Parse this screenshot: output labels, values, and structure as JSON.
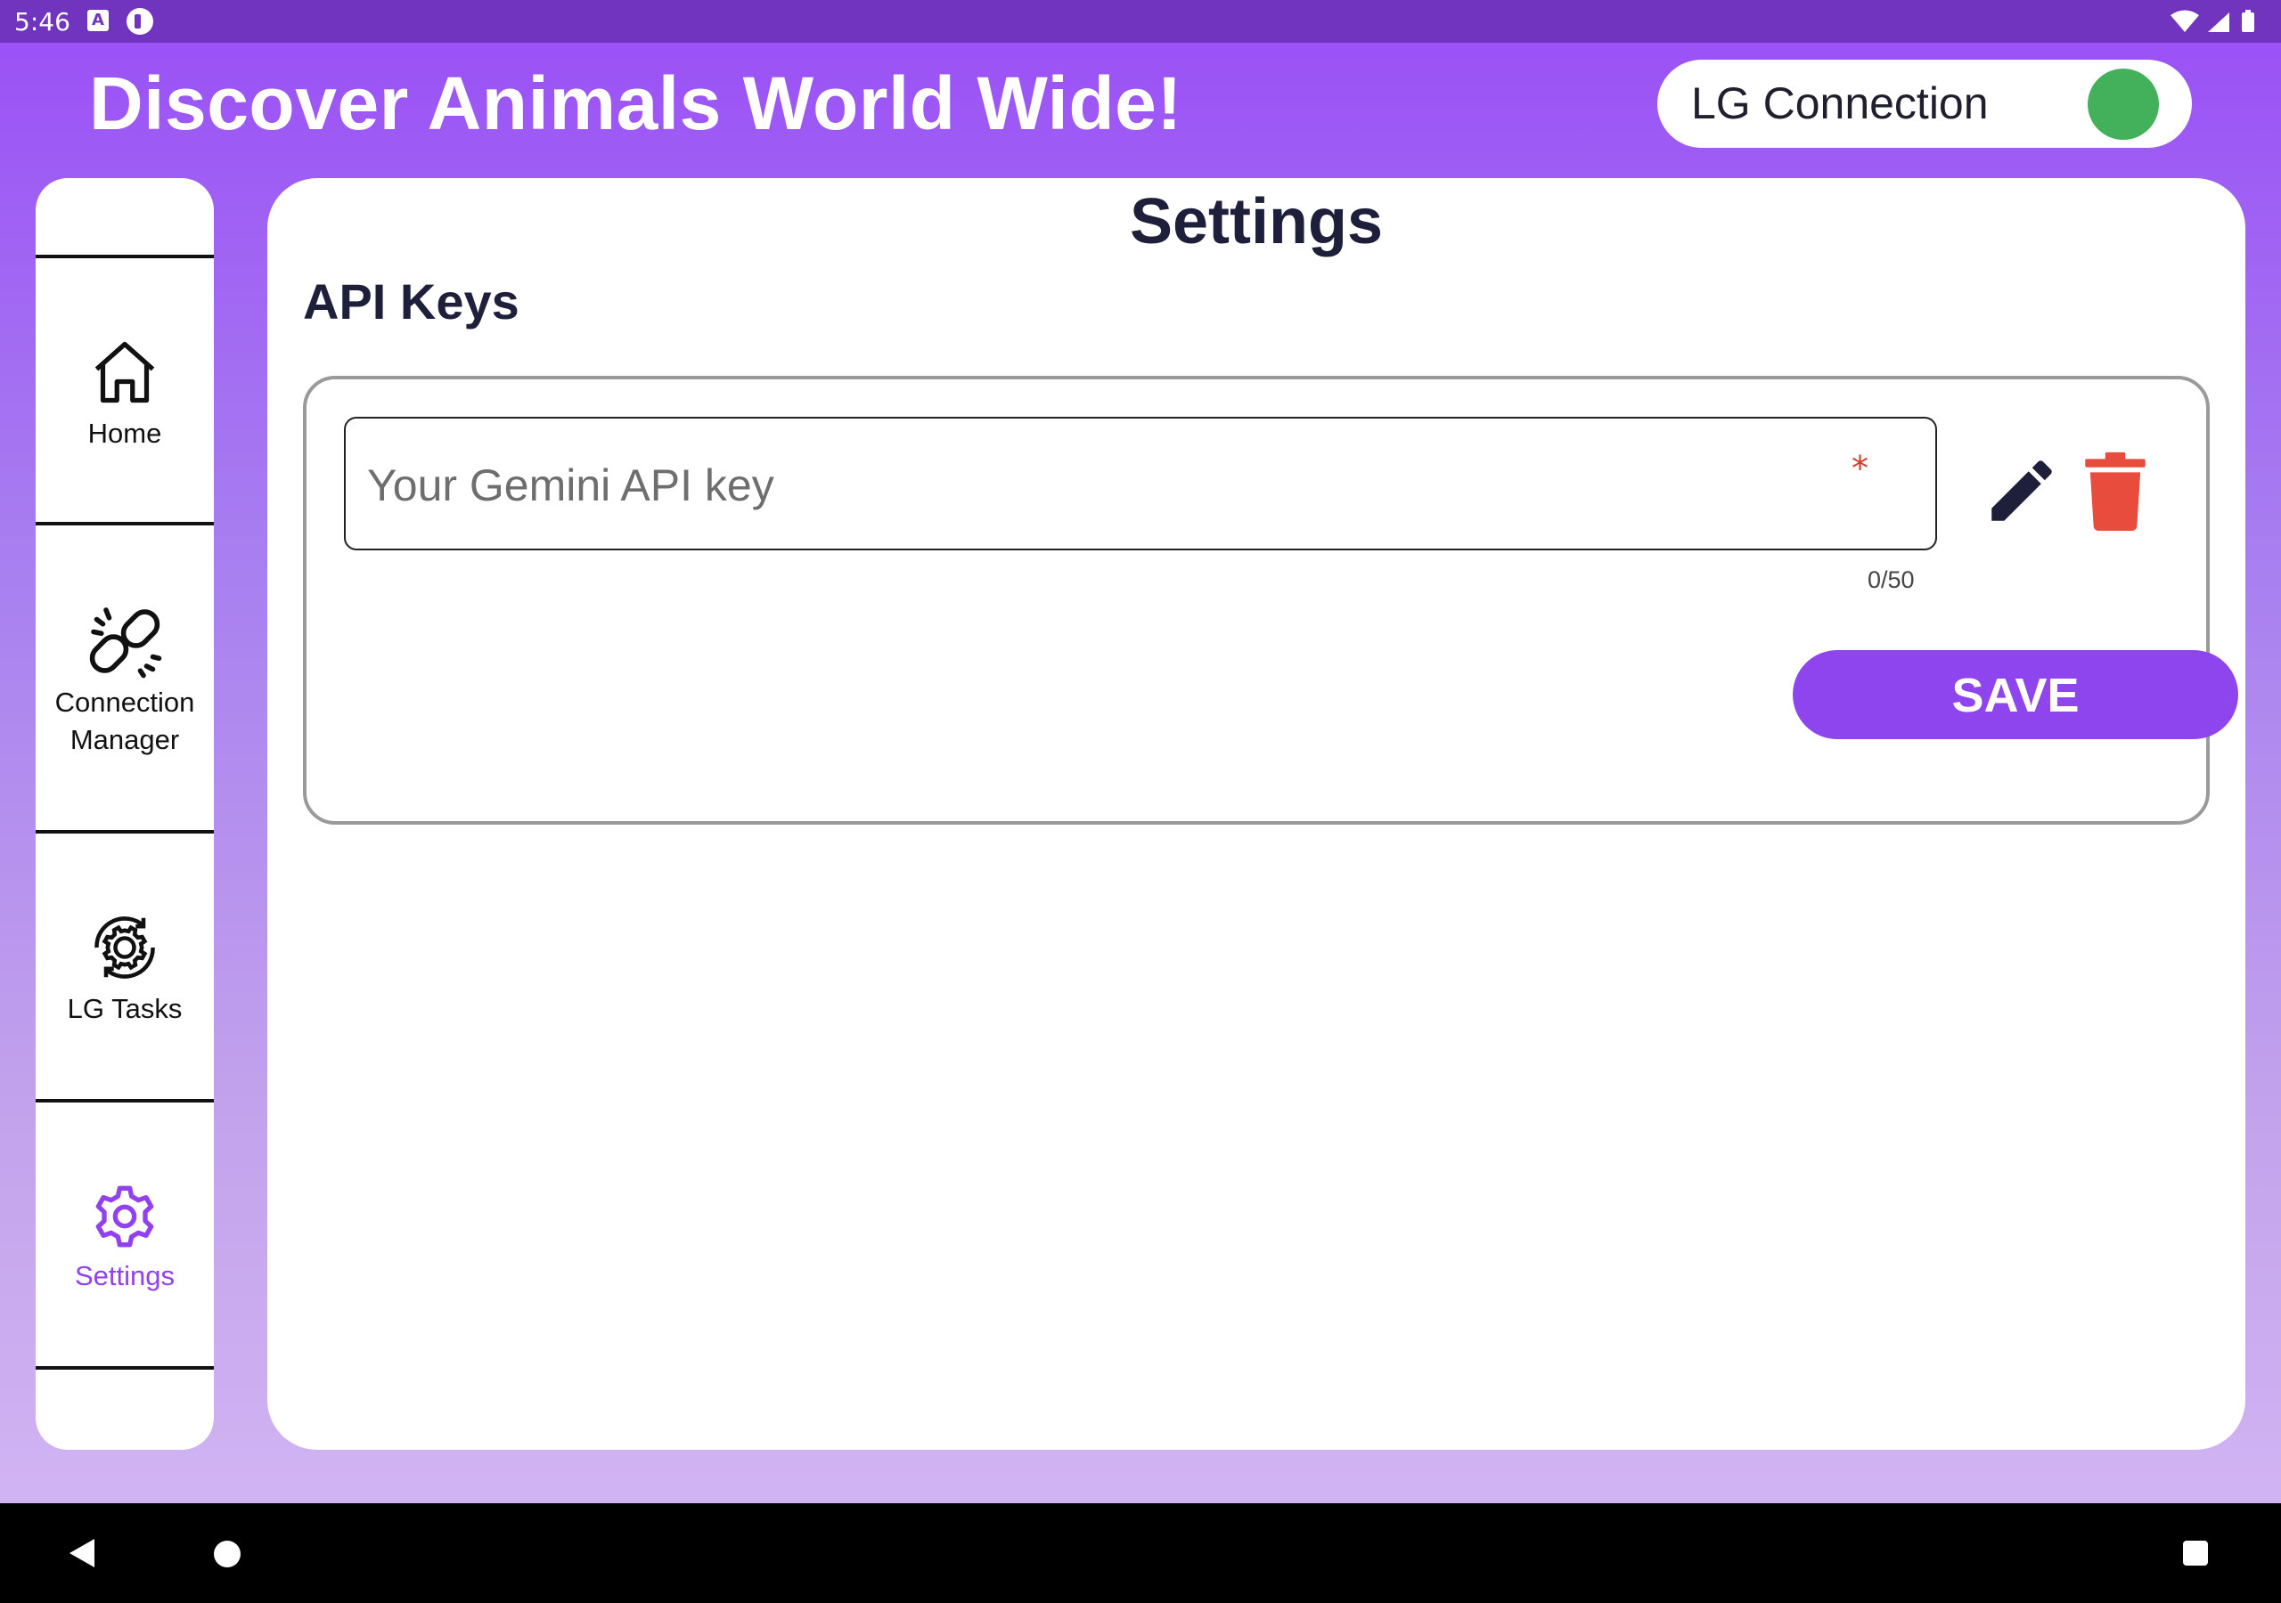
{
  "status_bar": {
    "time": "5:46",
    "notification_icons": [
      "a-icon",
      "p-icon"
    ],
    "system_icons": [
      "wifi-icon",
      "signal-icon",
      "battery-icon"
    ]
  },
  "header": {
    "title": "Discover Animals World Wide!",
    "connection_label": "LG Connection",
    "connection_status_color": "#43b05c"
  },
  "sidebar": {
    "items": [
      {
        "label": "Home",
        "icon": "home-icon"
      },
      {
        "label": "Connection\nManager",
        "icon": "link-icon"
      },
      {
        "label": "LG Tasks",
        "icon": "gear-refresh-icon"
      },
      {
        "label": "Settings",
        "icon": "gear-icon",
        "active": true
      }
    ],
    "active_color": "#9141f0"
  },
  "main": {
    "title": "Settings",
    "section_title": "API Keys",
    "api_key_input": {
      "placeholder": "Your Gemini API key",
      "required_marker": "*",
      "counter": "0/50"
    },
    "edit_icon": "pencil-icon",
    "delete_icon": "trash-icon",
    "save_label": "SAVE",
    "accent_color": "#8e45ee",
    "delete_color": "#e74c3c"
  },
  "nav_bar": {
    "buttons": [
      "back",
      "home",
      "recents"
    ]
  }
}
